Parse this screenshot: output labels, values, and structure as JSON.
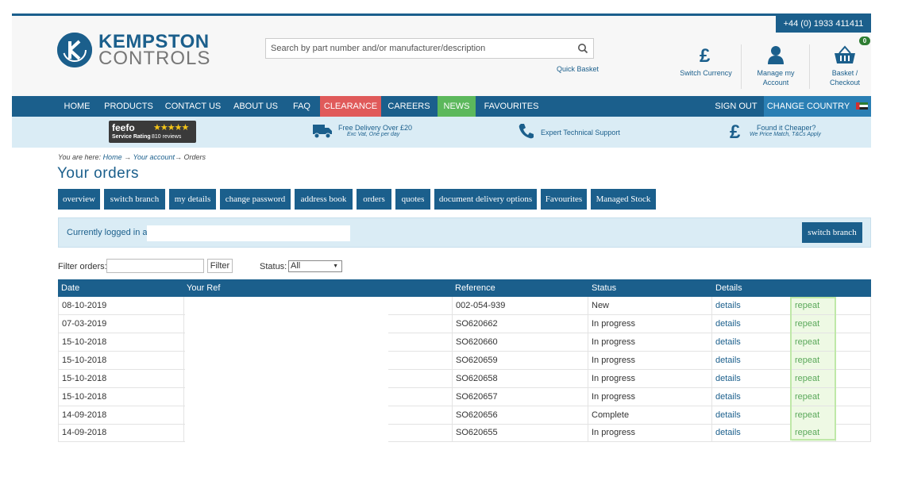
{
  "header": {
    "phone": "+44 (0) 1933 411411",
    "logo_line1": "KEMPSTON",
    "logo_line2": "CONTROLS",
    "search_placeholder": "Search by part number and/or manufacturer/description",
    "quick_basket": "Quick Basket",
    "switch_currency": "Switch Currency",
    "manage_account_l1": "Manage my",
    "manage_account_l2": "Account",
    "basket_l1": "Basket /",
    "basket_l2": "Checkout",
    "basket_count": "0"
  },
  "nav": {
    "home": "HOME",
    "products": "PRODUCTS",
    "contact": "CONTACT US",
    "about": "ABOUT US",
    "faq": "FAQ",
    "clearance": "CLEARANCE",
    "careers": "CAREERS",
    "news": "NEWS",
    "favourites": "FAVOURITES",
    "sign_out": "SIGN OUT",
    "change_country": "CHANGE COUNTRY"
  },
  "strip": {
    "feefo": "feefo",
    "service_rating": "Service Rating",
    "reviews": "810 reviews",
    "delivery": "Free Delivery Over £20",
    "delivery_sub": "Exc Vat, One per day",
    "support": "Expert Technical Support",
    "cheaper": "Found it Cheaper?",
    "cheaper_sub": "We Price Match, T&Cs Apply"
  },
  "breadcrumb": {
    "prefix": "You are here:",
    "home": "Home",
    "account": "Your account",
    "current": "Orders"
  },
  "page_title": "Your orders",
  "tabs": [
    "overview",
    "switch branch",
    "my details",
    "change password",
    "address book",
    "orders",
    "quotes",
    "document delivery options",
    "Favourites",
    "Managed Stock"
  ],
  "login": {
    "label": "Currently logged in as",
    "switch_branch": "switch branch"
  },
  "filter": {
    "label": "Filter orders:",
    "button": "Filter",
    "status_label": "Status:",
    "status_value": "All"
  },
  "table": {
    "headers": [
      "Date",
      "Your Ref",
      "Reference",
      "Status",
      "Details"
    ],
    "rows": [
      {
        "date": "08-10-2019",
        "reference": "002-054-939",
        "status": "New",
        "details": "details",
        "repeat": "repeat"
      },
      {
        "date": "07-03-2019",
        "reference": "SO620662",
        "status": "In progress",
        "details": "details",
        "repeat": "repeat"
      },
      {
        "date": "15-10-2018",
        "reference": "SO620660",
        "status": "In progress",
        "details": "details",
        "repeat": "repeat"
      },
      {
        "date": "15-10-2018",
        "reference": "SO620659",
        "status": "In progress",
        "details": "details",
        "repeat": "repeat"
      },
      {
        "date": "15-10-2018",
        "reference": "SO620658",
        "status": "In progress",
        "details": "details",
        "repeat": "repeat"
      },
      {
        "date": "15-10-2018",
        "reference": "SO620657",
        "status": "In progress",
        "details": "details",
        "repeat": "repeat"
      },
      {
        "date": "14-09-2018",
        "reference": "SO620656",
        "status": "Complete",
        "details": "details",
        "repeat": "repeat"
      },
      {
        "date": "14-09-2018",
        "reference": "SO620655",
        "status": "In progress",
        "details": "details",
        "repeat": "repeat"
      }
    ]
  },
  "colors": {
    "brand_blue": "#1b5f8c",
    "clearance_red": "#e05a5a",
    "news_green": "#5cb85c",
    "repeat_green": "#5aa85a"
  },
  "icons": [
    "kempston-logo-icon",
    "search-icon",
    "pound-icon",
    "user-icon",
    "basket-icon",
    "truck-icon",
    "phone-icon",
    "pound-price-match-icon",
    "uae-flag-icon",
    "star-icon",
    "dropdown-arrow-icon"
  ]
}
